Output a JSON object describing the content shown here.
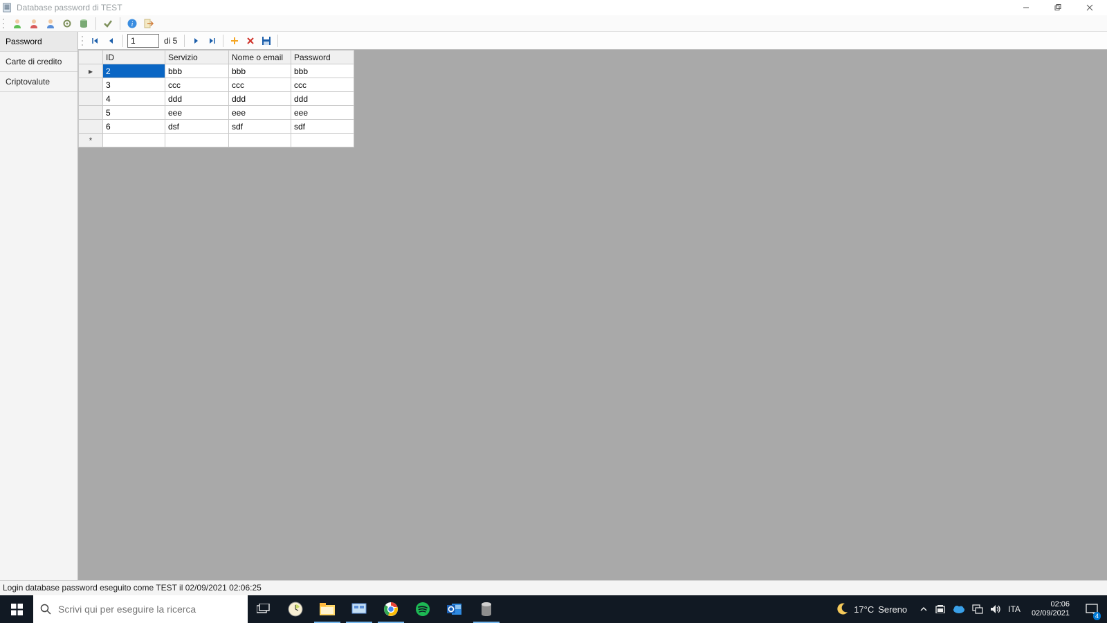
{
  "window": {
    "title": "Database password di TEST"
  },
  "sidebar": {
    "items": [
      {
        "label": "Password",
        "selected": true
      },
      {
        "label": "Carte di credito",
        "selected": false
      },
      {
        "label": "Criptovalute",
        "selected": false
      }
    ]
  },
  "navigator": {
    "current": "1",
    "of_label": "di 5"
  },
  "grid": {
    "columns": [
      "ID",
      "Servizio",
      "Nome o email",
      "Password"
    ],
    "rows": [
      {
        "id": "2",
        "servizio": "bbb",
        "nome": "bbb",
        "password": "bbb",
        "current": true
      },
      {
        "id": "3",
        "servizio": "ccc",
        "nome": "ccc",
        "password": "ccc",
        "current": false
      },
      {
        "id": "4",
        "servizio": "ddd",
        "nome": "ddd",
        "password": "ddd",
        "current": false
      },
      {
        "id": "5",
        "servizio": "eee",
        "nome": "eee",
        "password": "eee",
        "current": false
      },
      {
        "id": "6",
        "servizio": "dsf",
        "nome": "sdf",
        "password": "sdf",
        "current": false
      }
    ],
    "row_indicator_current": "▸",
    "row_indicator_new": "*"
  },
  "status": {
    "text": "Login database password eseguito come TEST il 02/09/2021 02:06:25"
  },
  "taskbar": {
    "search_placeholder": "Scrivi qui per eseguire la ricerca",
    "weather_temp": "17°C",
    "weather_cond": "Sereno",
    "lang": "ITA",
    "time": "02:06",
    "date": "02/09/2021",
    "notif_count": "4"
  }
}
